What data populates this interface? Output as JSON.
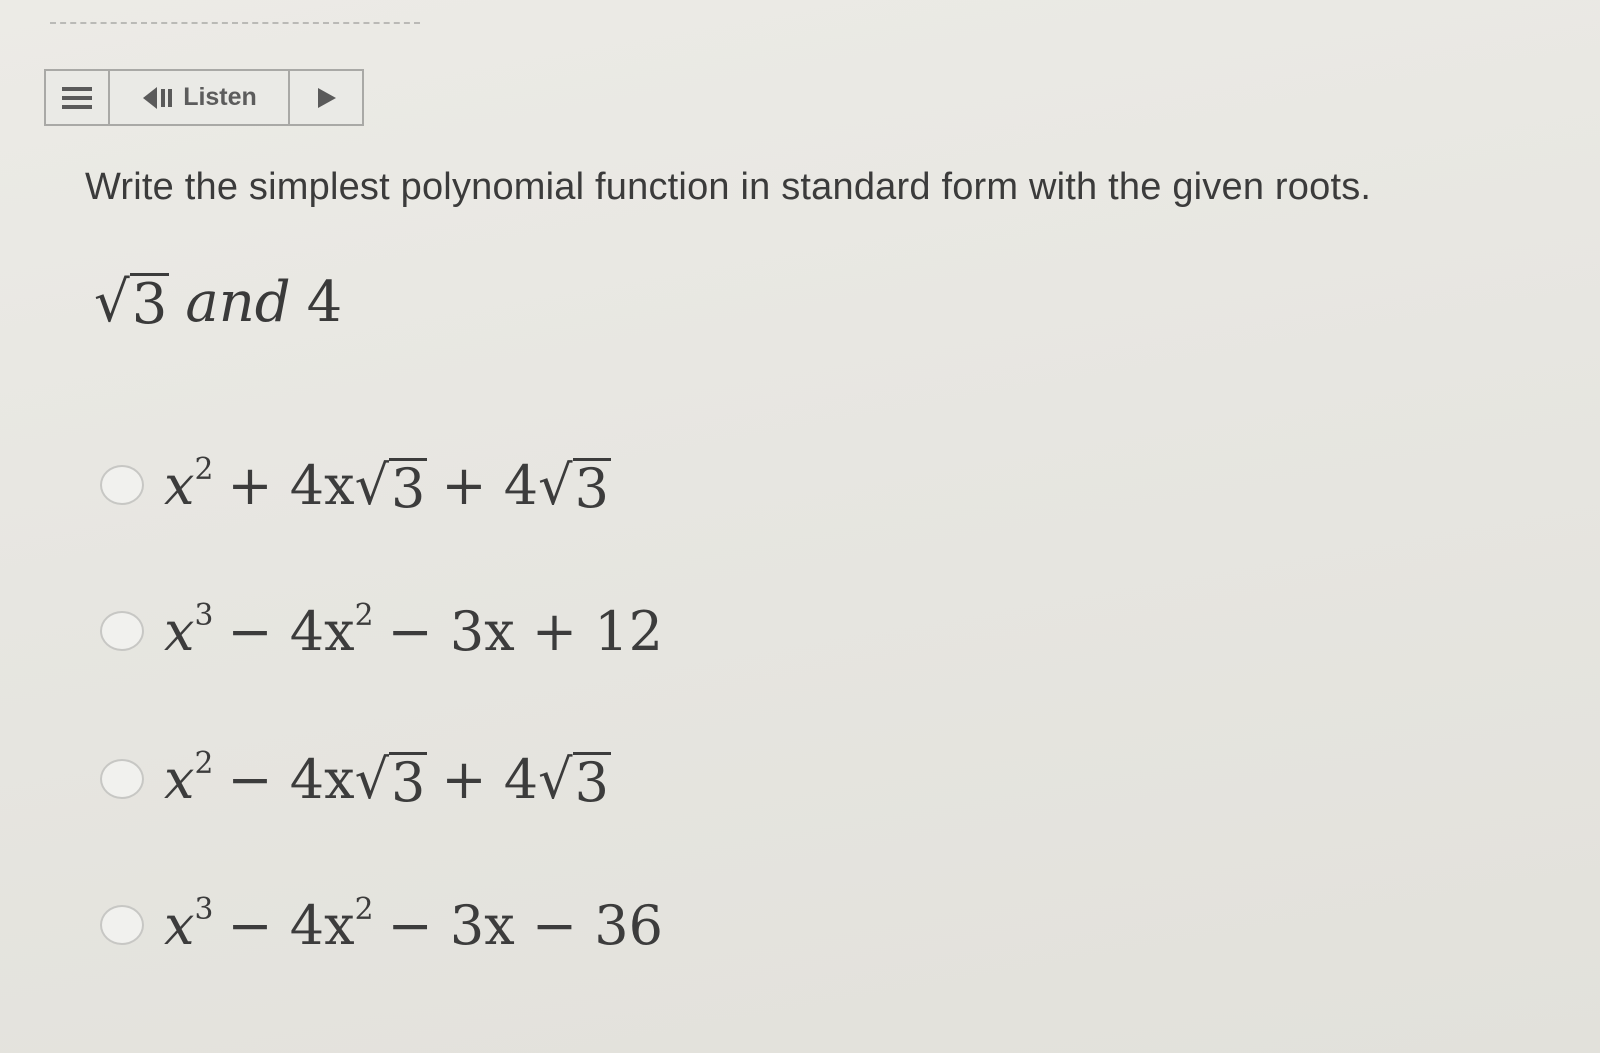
{
  "toolbar": {
    "menu_icon": "hamburger-menu-icon",
    "speaker_icon": "speaker-icon",
    "listen_label": "Listen",
    "play_icon": "play-icon"
  },
  "question": {
    "prompt": "Write the simplest polynomial function in standard form with the given roots.",
    "roots": {
      "root1_radicand": "3",
      "connector": "and",
      "root2": "4"
    }
  },
  "options": [
    {
      "parts": [
        "x",
        "2",
        "+ 4x",
        "3",
        "+ 4",
        "3"
      ]
    },
    {
      "parts": [
        "x",
        "3",
        "− 4x",
        "2",
        "− 3x + 12"
      ]
    },
    {
      "parts": [
        "x",
        "2",
        "− 4x",
        "3",
        "+ 4",
        "3"
      ]
    },
    {
      "parts": [
        "x",
        "3",
        "− 4x",
        "2",
        "− 3x − 36"
      ]
    }
  ],
  "colors": {
    "background": "#e8e7e2",
    "text": "#3b3b3b",
    "border": "#a9a9a6"
  }
}
